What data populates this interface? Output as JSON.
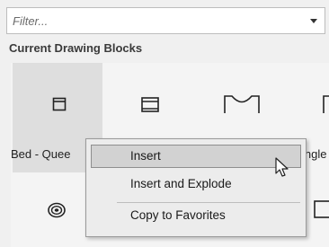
{
  "filter": {
    "placeholder": "Filter..."
  },
  "section": {
    "title": "Current Drawing Blocks"
  },
  "blocks": [
    {
      "label": "Bed - Quee",
      "icon": "bed-block-icon"
    },
    {
      "label": "",
      "icon": "sofa-block-icon"
    },
    {
      "label": "",
      "icon": "arch-block-icon"
    },
    {
      "label": "ingle",
      "icon": "partial-block-icon"
    },
    {
      "label": "",
      "icon": "ring-block-icon"
    },
    {
      "label": "",
      "icon": "rectangle-block-icon"
    }
  ],
  "context_menu": {
    "items": [
      {
        "label": "Insert"
      },
      {
        "label": "Insert and Explode"
      },
      {
        "label": "Copy to Favorites"
      }
    ]
  }
}
